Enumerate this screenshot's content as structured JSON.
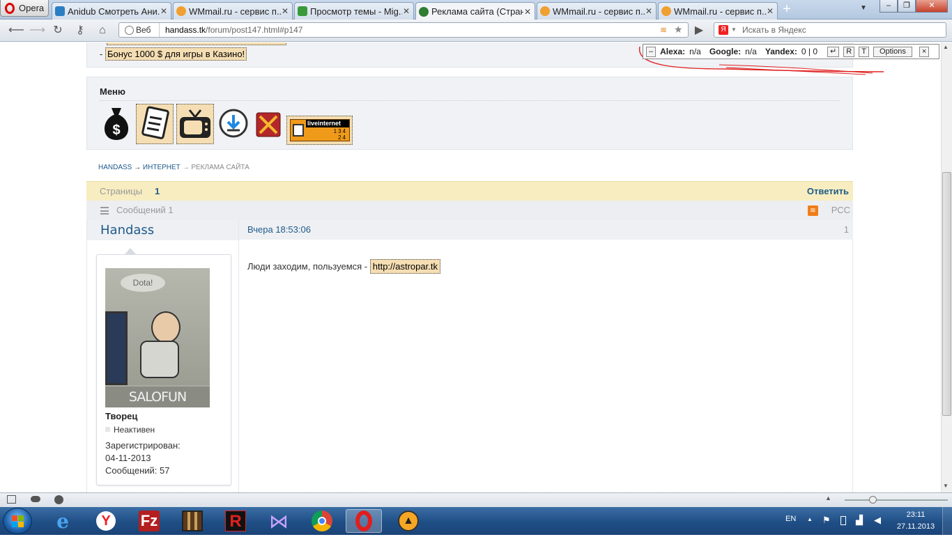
{
  "browser": {
    "opera_label": "Opera",
    "tabs": [
      {
        "title": "Anidub Смотреть Ани..."
      },
      {
        "title": "WMmail.ru - сервис п..."
      },
      {
        "title": "Просмотр темы - Mig..."
      },
      {
        "title": "Реклама сайта (Стран..."
      },
      {
        "title": "WMmail.ru - сервис п..."
      },
      {
        "title": "WMmail.ru - сервис п..."
      }
    ],
    "active_tab_index": 3,
    "address": {
      "web_label": "Веб",
      "domain": "handass.tk",
      "path": "/forum/post147.html#p147"
    },
    "search_placeholder": "Искать в Яндекс"
  },
  "seo_bar": {
    "alexa_label": "Alexa:",
    "alexa_value": "n/a",
    "google_label": "Google:",
    "google_value": "n/a",
    "yandex_label": "Yandex:",
    "yandex_value": "0 | 0",
    "btn_r": "R",
    "btn_t": "T",
    "options": "Options",
    "close": "×",
    "minus": "–"
  },
  "top_ad": {
    "prefix": "- ",
    "text": "Бонус 1000 $ для игры в Казино!"
  },
  "menu": {
    "title": "Меню",
    "liveinternet": {
      "name": "liveinternet",
      "line1": "134",
      "line2": "24"
    }
  },
  "breadcrumb": {
    "home": "HANDASS",
    "arrow1": "→",
    "section": "ИНТЕРНЕТ",
    "arrow2": "→",
    "current": "РЕКЛАМА САЙТА"
  },
  "pagination": {
    "label": "Страницы",
    "page": "1",
    "reply": "Ответить"
  },
  "topic": {
    "messages": "Сообщений 1",
    "rss": "РСС"
  },
  "post": {
    "author": "Handass",
    "time": "Вчера 18:53:06",
    "number": "1",
    "avatar_caption": "SALOFUN",
    "avatar_bubble": "Dota!",
    "rank": "Творец",
    "status": "Неактивен",
    "registered_label": "Зарегистрирован:",
    "registered_date": "04-11-2013",
    "posts_label": "Сообщений:",
    "posts_count": "57",
    "body_text": "Люди заходим, пользуемся - ",
    "link": "http://astropar.tk"
  },
  "taskbar": {
    "lang": "EN",
    "time": "23:11",
    "date": "27.11.2013"
  },
  "colors": {
    "link": "#1e5a8a",
    "highlight": "#f5deb3",
    "pages_bar": "#f7edc0"
  }
}
